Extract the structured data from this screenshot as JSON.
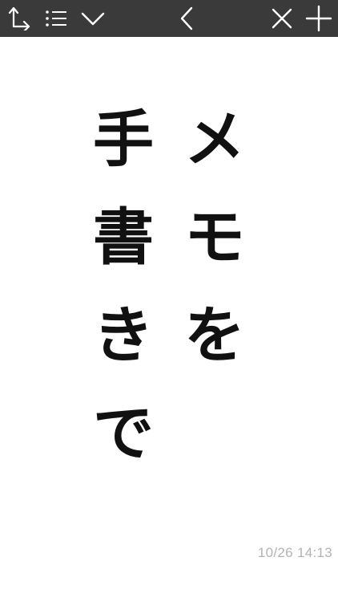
{
  "toolbar": {
    "background_color": "#3a3a3a",
    "icon_color": "#ffffff",
    "left_icons": [
      "export-arrow-icon",
      "list-icon",
      "chevron-down-icon"
    ],
    "center_icons": [
      "back-chevron-icon"
    ],
    "right_icons": [
      "close-icon",
      "plus-icon"
    ]
  },
  "memo": {
    "columns": [
      {
        "chars": [
          "メ",
          "モ",
          "を"
        ]
      },
      {
        "chars": [
          "手",
          "書",
          "き",
          "で"
        ]
      }
    ],
    "text_color": "#111111"
  },
  "footer": {
    "timestamp": "10/26 14:13",
    "timestamp_color": "#b3b3b3"
  }
}
